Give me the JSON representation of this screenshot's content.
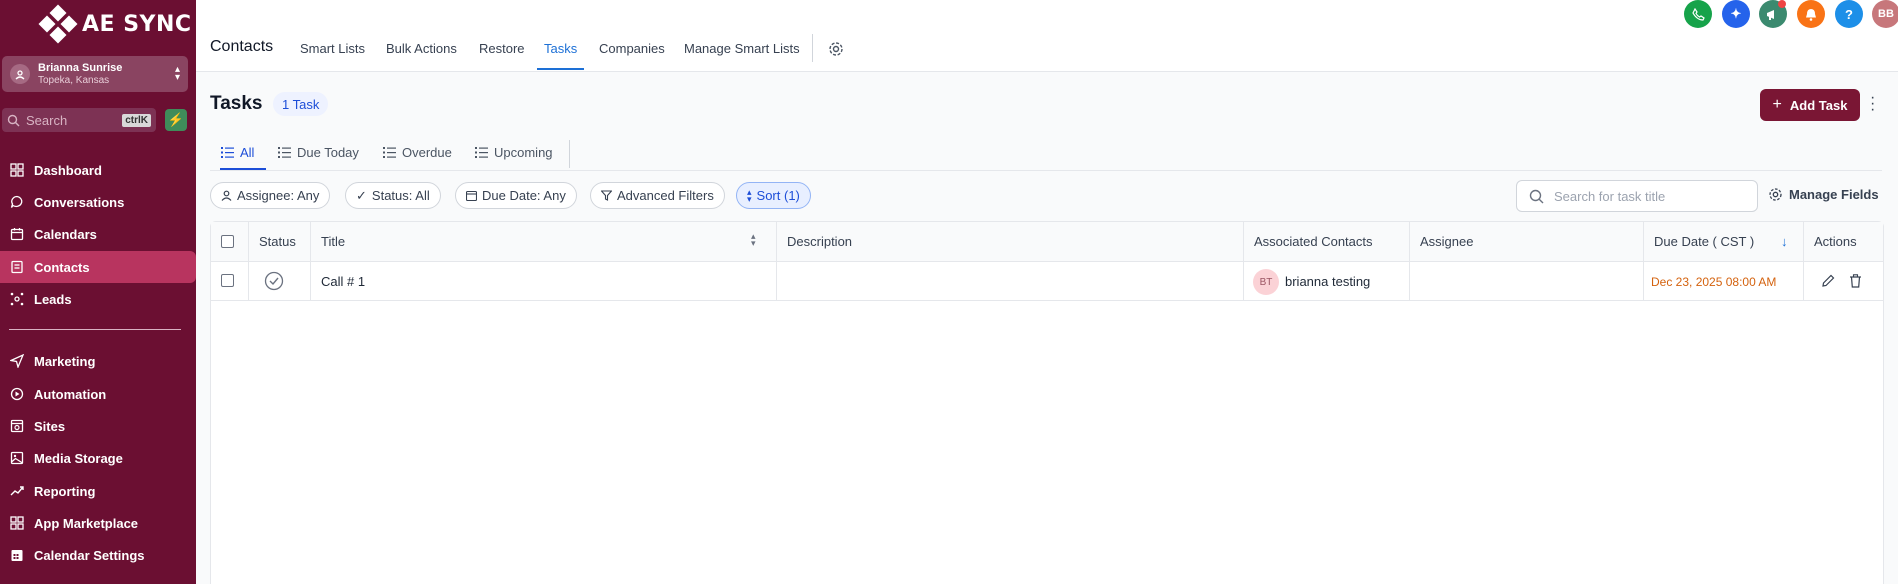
{
  "brand": {
    "name": "AE SYNC"
  },
  "account": {
    "name": "Brianna Sunrise",
    "location": "Topeka, Kansas"
  },
  "sidebar_search": {
    "placeholder": "Search",
    "shortcut": "ctrlK"
  },
  "sidebar": {
    "items": [
      {
        "label": "Dashboard",
        "icon": "grid-icon"
      },
      {
        "label": "Conversations",
        "icon": "chat-icon"
      },
      {
        "label": "Calendars",
        "icon": "calendar-icon"
      },
      {
        "label": "Contacts",
        "icon": "contacts-icon",
        "active": true
      },
      {
        "label": "Leads",
        "icon": "network-icon"
      },
      {
        "label": "Marketing",
        "icon": "send-icon"
      },
      {
        "label": "Automation",
        "icon": "automation-icon"
      },
      {
        "label": "Sites",
        "icon": "sites-icon"
      },
      {
        "label": "Media Storage",
        "icon": "image-icon"
      },
      {
        "label": "Reporting",
        "icon": "trend-icon"
      },
      {
        "label": "App Marketplace",
        "icon": "apps-icon"
      },
      {
        "label": "Calendar Settings",
        "icon": "calendar-grid-icon"
      }
    ]
  },
  "header": {
    "section": "Contacts",
    "tabs": [
      {
        "label": "Smart Lists"
      },
      {
        "label": "Bulk Actions"
      },
      {
        "label": "Restore"
      },
      {
        "label": "Tasks",
        "active": true
      },
      {
        "label": "Companies"
      },
      {
        "label": "Manage Smart Lists"
      }
    ],
    "avatar_initials": "BB",
    "help_label": "?"
  },
  "page": {
    "title": "Tasks",
    "count_badge": "1 Task",
    "add_button": "Add Task",
    "subtabs": [
      {
        "label": "All",
        "active": true
      },
      {
        "label": "Due Today"
      },
      {
        "label": "Overdue"
      },
      {
        "label": "Upcoming"
      }
    ],
    "filters": {
      "assignee": "Assignee: Any",
      "status": "Status: All",
      "due_date": "Due Date: Any",
      "advanced": "Advanced Filters",
      "sort": "Sort (1)"
    },
    "search_placeholder": "Search for task title",
    "manage_fields": "Manage Fields"
  },
  "table": {
    "columns": [
      "Status",
      "Title",
      "Description",
      "Associated Contacts",
      "Assignee",
      "Due Date ( CST )",
      "Actions"
    ],
    "rows": [
      {
        "title": "Call # 1",
        "description": "",
        "contact_initials": "BT",
        "contact_name": "brianna testing",
        "assignee": "",
        "due_date": "Dec 23, 2025 08:00 AM"
      }
    ]
  },
  "colors": {
    "sidebar_bg": "#6b0f32",
    "sidebar_active": "#b8345f",
    "accent_blue": "#1d70d6",
    "add_button": "#7a1634",
    "due_date": "#d4620e"
  }
}
